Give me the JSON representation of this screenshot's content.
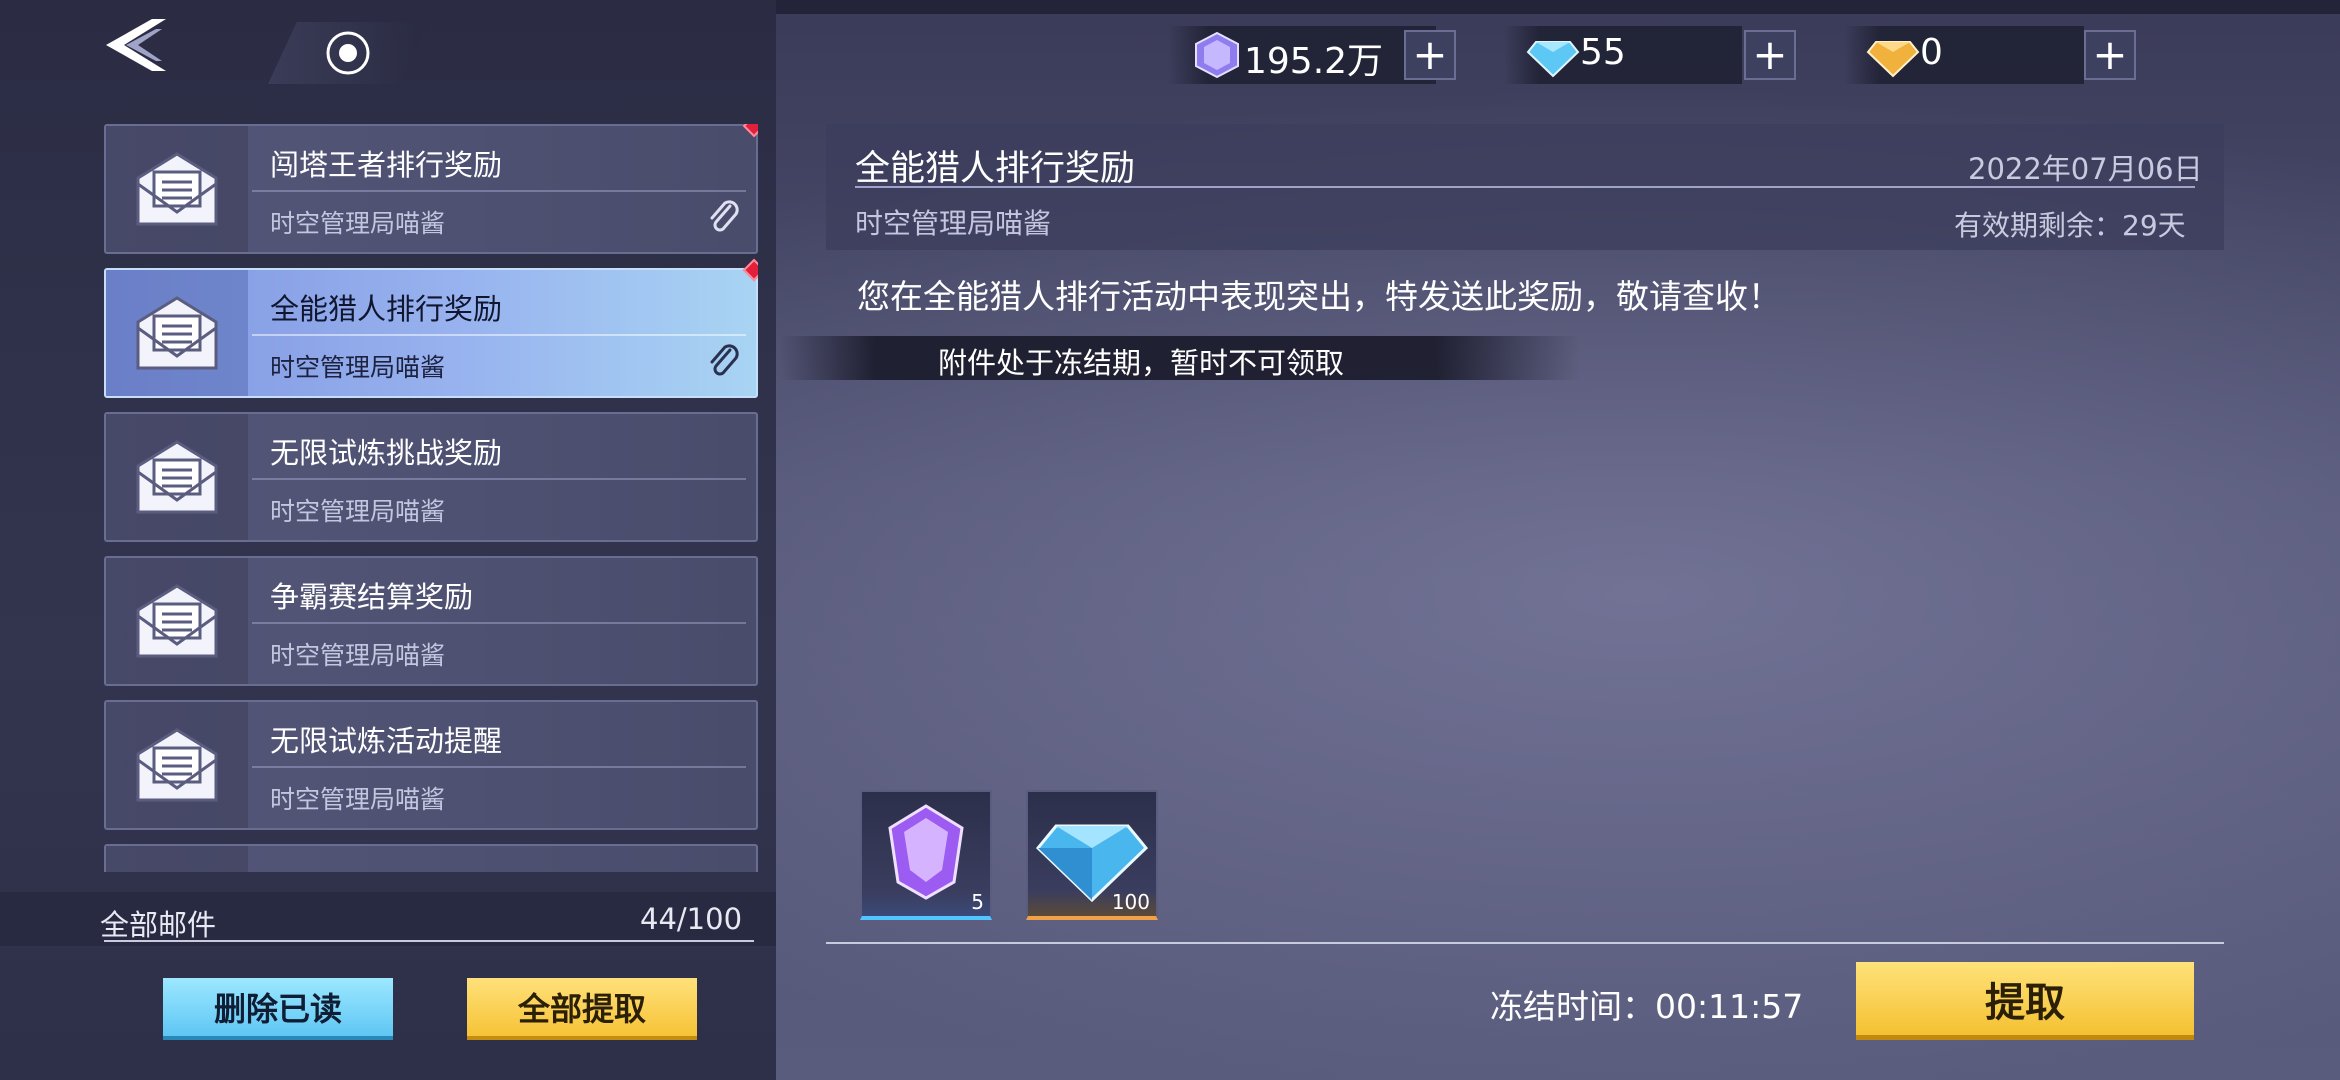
{
  "currencies": [
    {
      "icon": "purple-crystal-icon",
      "value": "195.2万"
    },
    {
      "icon": "blue-diamond-icon",
      "value": "55"
    },
    {
      "icon": "gold-diamond-icon",
      "value": "0"
    }
  ],
  "plus_label": "+",
  "mail_list": {
    "items": [
      {
        "title": "闯塔王者排行奖励",
        "sender": "时空管理局喵酱",
        "has_attachment": true,
        "unread": true
      },
      {
        "title": "全能猎人排行奖励",
        "sender": "时空管理局喵酱",
        "has_attachment": true,
        "unread": true,
        "selected": true
      },
      {
        "title": "无限试炼挑战奖励",
        "sender": "时空管理局喵酱",
        "has_attachment": false,
        "unread": false
      },
      {
        "title": "争霸赛结算奖励",
        "sender": "时空管理局喵酱",
        "has_attachment": false,
        "unread": false
      },
      {
        "title": "无限试炼活动提醒",
        "sender": "时空管理局喵酱",
        "has_attachment": false,
        "unread": false
      }
    ],
    "footer_label": "全部邮件",
    "footer_count": "44/100",
    "delete_read_label": "删除已读",
    "claim_all_label": "全部提取"
  },
  "detail": {
    "title": "全能猎人排行奖励",
    "date": "2022年07月06日",
    "sender": "时空管理局喵酱",
    "expire": "有效期剩余：29天",
    "body": "您在全能猎人排行活动中表现突出，特发送此奖励，敬请查收！",
    "freeze_notice": "附件处于冻结期，暂时不可领取",
    "attachments": [
      {
        "icon": "purple-crystal-icon",
        "count": "5"
      },
      {
        "icon": "blue-diamond-icon",
        "count": "100"
      }
    ],
    "freeze_time": "冻结时间：00:11:57",
    "claim_label": "提取"
  },
  "colors": {
    "selected_mail": "#98b3ef",
    "claim_button": "#f4c132",
    "delete_button": "#5fc6f4",
    "red_dot": "#e3203c"
  }
}
